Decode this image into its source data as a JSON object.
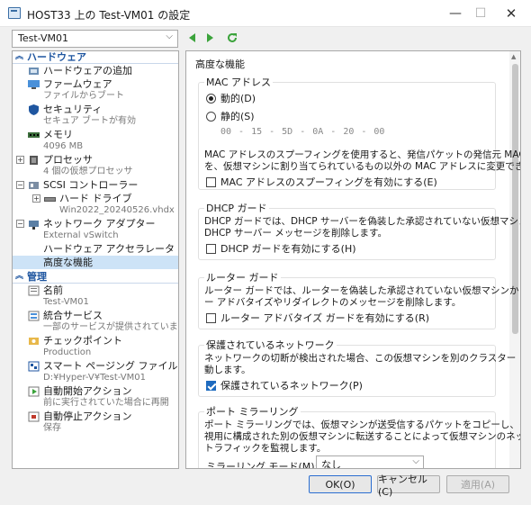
{
  "window": {
    "title": "HOST33 上の Test-VM01 の設定",
    "min_symbol": "—",
    "max_symbol": "☐",
    "close_symbol": "✕"
  },
  "toolbar": {
    "vm_selected": "Test-VM01",
    "icons": [
      "back-arrow-icon",
      "forward-arrow-icon",
      "refresh-icon"
    ]
  },
  "tree": {
    "hardware_header": "ハードウェア",
    "management_header": "管理",
    "hardware_items": [
      {
        "main": "ハードウェアの追加",
        "sub": ""
      },
      {
        "main": "ファームウェア",
        "sub": "ファイルからブート"
      },
      {
        "main": "セキュリティ",
        "sub": "セキュア ブートが有効"
      },
      {
        "main": "メモリ",
        "sub": "4096 MB"
      },
      {
        "main": "プロセッサ",
        "sub": "4 個の仮想プロセッサ"
      },
      {
        "main": "SCSI コントローラー",
        "sub": ""
      },
      {
        "main": "ハード ドライブ",
        "sub": "Win2022_20240526.vhdx"
      },
      {
        "main": "ネットワーク アダプター",
        "sub": "External vSwitch"
      },
      {
        "main": "ハードウェア アクセラレータ",
        "sub": ""
      },
      {
        "main": "高度な機能",
        "sub": ""
      }
    ],
    "management_items": [
      {
        "main": "名前",
        "sub": "Test-VM01"
      },
      {
        "main": "統合サービス",
        "sub": "一部のサービスが提供されています"
      },
      {
        "main": "チェックポイント",
        "sub": "Production"
      },
      {
        "main": "スマート ページング ファイルの場所",
        "sub": "D:¥Hyper-V¥Test-VM01"
      },
      {
        "main": "自動開始アクション",
        "sub": "前に実行されていた場合に再開"
      },
      {
        "main": "自動停止アクション",
        "sub": "保存"
      }
    ]
  },
  "panel": {
    "title": "高度な機能",
    "mac": {
      "label": "MAC アドレス",
      "dynamic": "動的(D)",
      "static": "静的(S)",
      "octets": [
        "00",
        "15",
        "5D",
        "0A",
        "20",
        "00"
      ],
      "desc1": "MAC アドレスのスプーフィングを使用すると、発信パケットの発信元 MAC アドレス",
      "desc2": "を、仮想マシンに割り当てられているもの以外の MAC アドレスに変更できます。",
      "spoof_check": "MAC アドレスのスプーフィングを有効にする(E)"
    },
    "dhcp": {
      "label": "DHCP ガード",
      "desc1": "DHCP ガードでは、DHCP サーバーを偽装した承認されていない仮想マシンからの",
      "desc2": "DHCP サーバー メッセージを削除します。",
      "check": "DHCP ガードを有効にする(H)"
    },
    "router": {
      "label": "ルーター ガード",
      "desc1": "ルーター ガードでは、ルーターを偽装した承認されていない仮想マシンからのルータ",
      "desc2": "ー アドバタイズやリダイレクトのメッセージを削除します。",
      "check": "ルーター アドバタイズ ガードを有効にする(R)"
    },
    "protected": {
      "label": "保護されているネットワーク",
      "desc1": "ネットワークの切断が検出された場合、この仮想マシンを別のクラスター ノードに移",
      "desc2": "動します。",
      "check": "保護されているネットワーク(P)"
    },
    "mirror": {
      "label": "ポート ミラーリング",
      "desc1": "ポート ミラーリングでは、仮想マシンが送受信するパケットをコピーし、そのコピーを監",
      "desc2": "視用に構成された別の仮想マシンに転送することによって仮想マシンのネットワーク",
      "desc3": "トラフィックを監視します。",
      "mode_label": "ミラーリング モード(M):",
      "mode_value": "なし"
    }
  },
  "buttons": {
    "ok": "OK(O)",
    "cancel": "キャンセル(C)",
    "apply": "適用(A)"
  }
}
